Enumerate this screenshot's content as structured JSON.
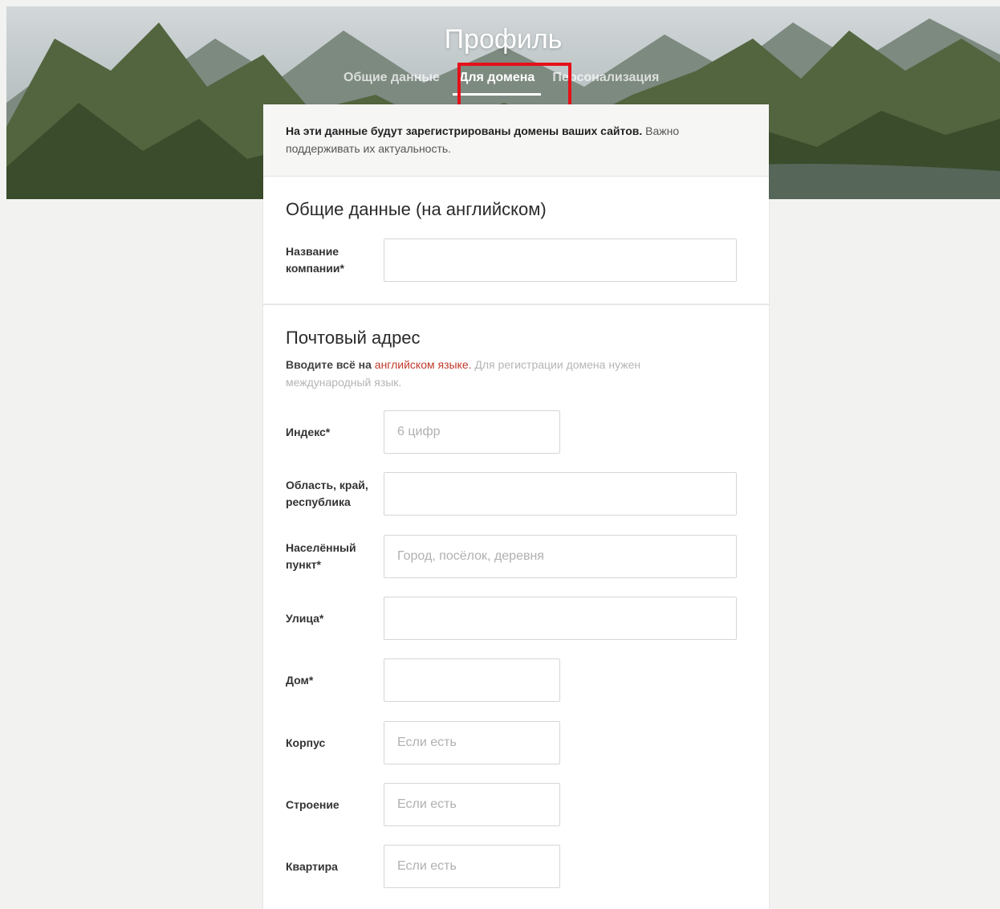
{
  "header": {
    "title": "Профиль",
    "tabs": [
      {
        "label": "Общие данные",
        "active": false
      },
      {
        "label": "Для домена",
        "active": true
      },
      {
        "label": "Персонализация",
        "active": false
      }
    ],
    "highlight_color": "#e6101a"
  },
  "notice": {
    "bold": "На эти данные будут зарегистрированы домены ваших сайтов.",
    "rest": " Важно поддерживать их актуальность."
  },
  "general": {
    "title": "Общие данные (на английском)",
    "company_label": "Название компании*",
    "company_value": ""
  },
  "postal": {
    "title": "Почтовый адрес",
    "hint_lead": "Вводите всё на ",
    "hint_red": "английском языке.",
    "hint_rest": " Для регистрации домена нужен международный язык.",
    "fields": {
      "index": {
        "label": "Индекс*",
        "placeholder": "6 цифр"
      },
      "region": {
        "label": "Область, край, республика",
        "placeholder": ""
      },
      "city": {
        "label": "Населённый пункт*",
        "placeholder": "Город, посёлок, деревня"
      },
      "street": {
        "label": "Улица*",
        "placeholder": ""
      },
      "house": {
        "label": "Дом*",
        "placeholder": ""
      },
      "building": {
        "label": "Корпус",
        "placeholder": "Если есть"
      },
      "structure": {
        "label": "Строение",
        "placeholder": "Если есть"
      },
      "apartment": {
        "label": "Квартира",
        "placeholder": "Если есть"
      }
    }
  }
}
